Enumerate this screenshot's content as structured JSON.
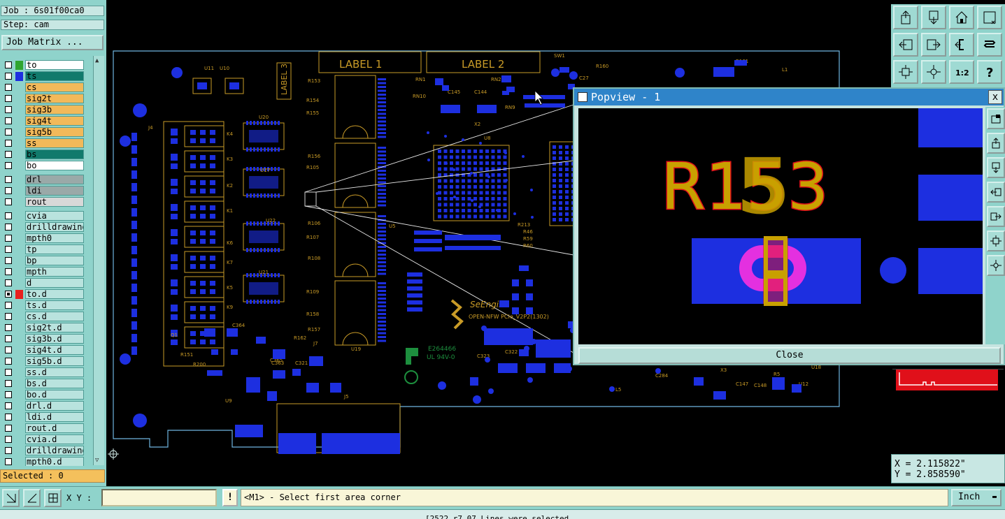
{
  "job": {
    "job_label": "Job : 6s01f00ca0",
    "step_label": "Step: cam",
    "job_matrix_label": "Job Matrix ..."
  },
  "layers": [
    {
      "name": "to",
      "bg": "#ffffff",
      "swatch": "#2fa52f",
      "checked": false,
      "mark": ""
    },
    {
      "name": "ts",
      "bg": "#117a6c",
      "swatch": "#1d2fe0",
      "checked": false,
      "mark": ""
    },
    {
      "name": "cs",
      "bg": "#f2b95a",
      "swatch": "",
      "checked": false,
      "mark": ""
    },
    {
      "name": "sig2t",
      "bg": "#f2b95a",
      "swatch": "",
      "checked": false,
      "mark": "✍"
    },
    {
      "name": "sig3b",
      "bg": "#f2b95a",
      "swatch": "",
      "checked": false,
      "mark": ""
    },
    {
      "name": "sig4t",
      "bg": "#f2b95a",
      "swatch": "",
      "checked": false,
      "mark": "✍"
    },
    {
      "name": "sig5b",
      "bg": "#f2b95a",
      "swatch": "",
      "checked": false,
      "mark": "✍"
    },
    {
      "name": "ss",
      "bg": "#f2b95a",
      "swatch": "",
      "checked": false,
      "mark": ""
    },
    {
      "name": "bs",
      "bg": "#117a6c",
      "swatch": "",
      "checked": false,
      "mark": ""
    },
    {
      "name": "bo",
      "bg": "#ffffff",
      "swatch": "",
      "checked": false,
      "mark": ""
    },
    {
      "name": "drl",
      "bg": "#9aa9a8",
      "swatch": "",
      "checked": false,
      "mark": ""
    },
    {
      "name": "ldi",
      "bg": "#9aa9a8",
      "swatch": "",
      "checked": false,
      "mark": ""
    },
    {
      "name": "rout",
      "bg": "#d8d8d8",
      "swatch": "",
      "checked": false,
      "mark": ""
    },
    {
      "name": "cvia",
      "bg": "#b9e3de",
      "swatch": "",
      "checked": false,
      "mark": ""
    },
    {
      "name": "drilldrawing",
      "bg": "#b9e3de",
      "swatch": "",
      "checked": false,
      "mark": ""
    },
    {
      "name": "mpth0",
      "bg": "#b9e3de",
      "swatch": "",
      "checked": false,
      "mark": ""
    },
    {
      "name": "tp",
      "bg": "#b9e3de",
      "swatch": "",
      "checked": false,
      "mark": ""
    },
    {
      "name": "bp",
      "bg": "#b9e3de",
      "swatch": "",
      "checked": false,
      "mark": ""
    },
    {
      "name": "mpth",
      "bg": "#b9e3de",
      "swatch": "",
      "checked": false,
      "mark": ""
    },
    {
      "name": "d",
      "bg": "#b9e3de",
      "swatch": "",
      "checked": false,
      "mark": ""
    },
    {
      "name": "to.d",
      "bg": "#b9e3de",
      "swatch": "#e8201e",
      "checked": true,
      "mark": "⊞"
    },
    {
      "name": "ts.d",
      "bg": "#b9e3de",
      "swatch": "",
      "checked": false,
      "mark": ""
    },
    {
      "name": "cs.d",
      "bg": "#b9e3de",
      "swatch": "",
      "checked": false,
      "mark": ""
    },
    {
      "name": "sig2t.d",
      "bg": "#b9e3de",
      "swatch": "",
      "checked": false,
      "mark": "✍"
    },
    {
      "name": "sig3b.d",
      "bg": "#b9e3de",
      "swatch": "",
      "checked": false,
      "mark": "✍"
    },
    {
      "name": "sig4t.d",
      "bg": "#b9e3de",
      "swatch": "",
      "checked": false,
      "mark": "✍"
    },
    {
      "name": "sig5b.d",
      "bg": "#b9e3de",
      "swatch": "",
      "checked": false,
      "mark": "✍"
    },
    {
      "name": "ss.d",
      "bg": "#b9e3de",
      "swatch": "",
      "checked": false,
      "mark": ""
    },
    {
      "name": "bs.d",
      "bg": "#b9e3de",
      "swatch": "",
      "checked": false,
      "mark": ""
    },
    {
      "name": "bo.d",
      "bg": "#b9e3de",
      "swatch": "",
      "checked": false,
      "mark": ""
    },
    {
      "name": "drl.d",
      "bg": "#b9e3de",
      "swatch": "",
      "checked": false,
      "mark": ""
    },
    {
      "name": "ldi.d",
      "bg": "#b9e3de",
      "swatch": "",
      "checked": false,
      "mark": ""
    },
    {
      "name": "rout.d",
      "bg": "#b9e3de",
      "swatch": "",
      "checked": false,
      "mark": ""
    },
    {
      "name": "cvia.d",
      "bg": "#b9e3de",
      "swatch": "",
      "checked": false,
      "mark": ""
    },
    {
      "name": "drilldrawing",
      "bg": "#b9e3de",
      "swatch": "",
      "checked": false,
      "mark": ""
    },
    {
      "name": "mpth0.d",
      "bg": "#b9e3de",
      "swatch": "",
      "checked": false,
      "mark": ""
    }
  ],
  "selected_label": "Selected : 0",
  "board_text": {
    "label1": "LABEL 1",
    "label2": "LABEL 2",
    "label3": "LABEL 3",
    "refs": [
      "U11",
      "U10",
      "U20",
      "U17",
      "U22",
      "U21",
      "J4",
      "K4",
      "K3",
      "K2",
      "K1",
      "K6",
      "K7",
      "K5",
      "K9",
      "R153",
      "R154",
      "R155",
      "R156",
      "R105",
      "R106",
      "R107",
      "R108",
      "R109",
      "R158",
      "R157",
      "R162",
      "J7",
      "U19",
      "U9",
      "U5",
      "U8",
      "X2",
      "C145",
      "C144",
      "RN1",
      "RN2",
      "RN10",
      "RN9",
      "SW1",
      "R160",
      "C27",
      "R161",
      "L1",
      "C364",
      "Q1",
      "R151",
      "R200",
      "C365",
      "C363",
      "C321",
      "J5",
      "C322",
      "C323",
      "L5",
      "C284",
      "X3",
      "C147",
      "C148",
      "R5",
      "U12",
      "U18",
      "R46",
      "R59",
      "R60",
      "R213"
    ],
    "logo_line1": "SeEngine",
    "logo_line2": "OPEN-NFW PCIe_V2P2(1302)",
    "ul_line1": "E264466",
    "ul_line2": "UL 94V-0"
  },
  "popview": {
    "title": "Popview - 1",
    "zoomed_ref": "R153",
    "close_label": "Close",
    "close_x": "x"
  },
  "coords": {
    "x_label": "X = 2.115822\"",
    "y_label": "Y = 2.858590\""
  },
  "bottom": {
    "xy_label": "X Y :",
    "xy_value": "",
    "bang_label": "!",
    "prompt": "<M1> - Select first area corner",
    "units": "Inch"
  },
  "status_text": "[2522.r7.07 Lines were selected",
  "icons": {
    "toolbar": [
      "zoom-home-icon",
      "zoom-back-icon",
      "house-icon",
      "grid-close-icon",
      "pan-left-icon",
      "pan-right-icon",
      "undo-view-icon",
      "redraw-icon",
      "zoom-fit-icon",
      "zoom-center-icon",
      "scale-1to2-icon",
      "help-icon"
    ]
  },
  "colors": {
    "panel": "#8fd3cb",
    "copper": "#1d2fe0",
    "silkscreen": "#c99b27",
    "outline": "#6fb5e0",
    "solder": "#c8a000",
    "pink": "#e430e0",
    "red": "#e0101a"
  }
}
